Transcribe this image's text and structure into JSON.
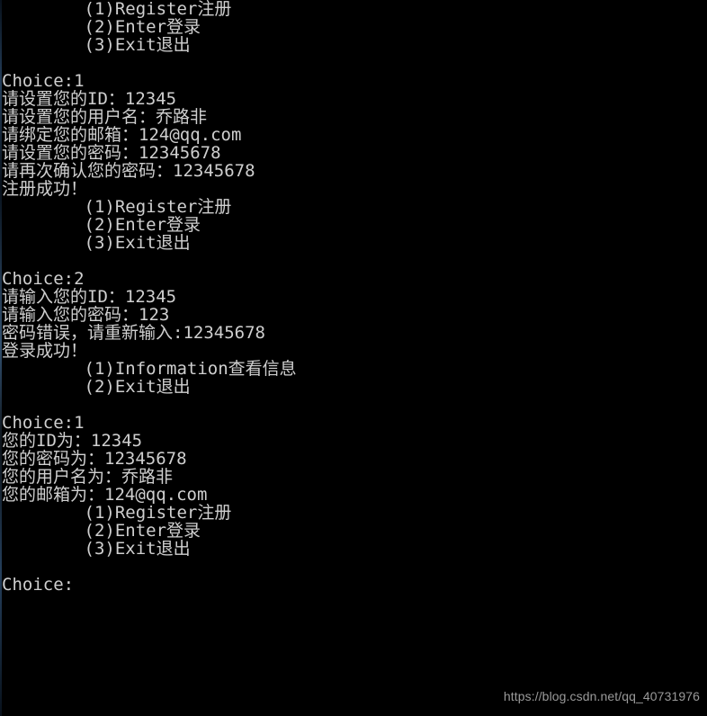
{
  "window": {
    "title": "Console Output",
    "background_color": "#000000",
    "text_color": "#cfcfcf"
  },
  "watermark": {
    "text": "https://blog.csdn.net/qq_40731976",
    "color": "#9a9a9a"
  },
  "terminal": {
    "lines": [
      "        (1)Register注册",
      "        (2)Enter登录",
      "        (3)Exit退出",
      "",
      "Choice:1",
      "请设置您的ID：12345",
      "请设置您的用户名：乔路非",
      "请绑定您的邮箱：124@qq.com",
      "请设置您的密码：12345678",
      "请再次确认您的密码：12345678",
      "注册成功！",
      "        (1)Register注册",
      "        (2)Enter登录",
      "        (3)Exit退出",
      "",
      "Choice:2",
      "请输入您的ID：12345",
      "请输入您的密码：123",
      "密码错误，请重新输入:12345678",
      "登录成功！",
      "        (1)Information查看信息",
      "        (2)Exit退出",
      "",
      "Choice:1",
      "您的ID为：12345",
      "您的密码为：12345678",
      "您的用户名为：乔路非",
      "您的邮箱为：124@qq.com",
      "        (1)Register注册",
      "        (2)Enter登录",
      "        (3)Exit退出",
      "",
      "Choice:"
    ],
    "menu_main": [
      "(1)Register注册",
      "(2)Enter登录",
      "(3)Exit退出"
    ],
    "menu_logged_in": [
      "(1)Information查看信息",
      "(2)Exit退出"
    ],
    "prompts": {
      "choice": "Choice:",
      "set_id": "请设置您的ID：",
      "set_username": "请设置您的用户名：",
      "bind_email": "请绑定您的邮箱：",
      "set_password": "请设置您的密码：",
      "confirm_password": "请再次确认您的密码：",
      "register_success": "注册成功！",
      "input_id": "请输入您的ID：",
      "input_password": "请输入您的密码：",
      "password_error": "密码错误，请重新输入:",
      "login_success": "登录成功！",
      "info_id": "您的ID为：",
      "info_password": "您的密码为：",
      "info_username": "您的用户名为：",
      "info_email": "您的邮箱为："
    },
    "values": {
      "choice_1": "1",
      "choice_2": "2",
      "choice_3": "1",
      "choice_last": "",
      "id": "12345",
      "username": "乔路非",
      "email": "124@qq.com",
      "password": "12345678",
      "password_confirm": "12345678",
      "wrong_password": "123",
      "retry_password": "12345678"
    }
  }
}
